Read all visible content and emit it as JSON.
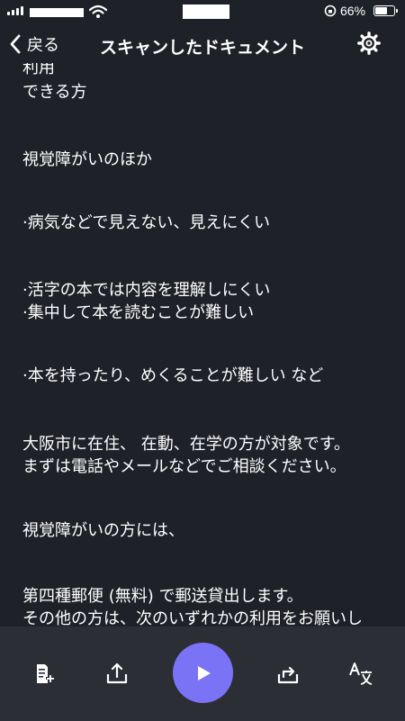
{
  "status_bar": {
    "battery_text": "66%",
    "battery_level": 0.66
  },
  "nav": {
    "back_label": "戻る",
    "title": "スキャンしたドキュメント"
  },
  "document": {
    "lines": [
      "利用",
      "できる方",
      "視覚障がいのほか",
      "·病気などで見えない、見えにくい",
      "·活字の本では内容を理解しにくい",
      "·集中して本を読むことが難しい",
      "·本を持ったり、めくることが難しい など",
      "大阪市に在住、 在動、在学の方が対象です。",
      "まずは電話やメールなどでご相談ください。",
      "視覚障がいの方には、",
      "第四種郵便 (無料) で郵送貸出します。",
      "その他の方は、次のいずれかの利用をお願いし"
    ]
  },
  "toolbar": {
    "icons": [
      "add-page-icon",
      "share-icon",
      "play-icon",
      "rescan-icon",
      "translate-icon"
    ],
    "accent_color": "#7b73f5"
  }
}
